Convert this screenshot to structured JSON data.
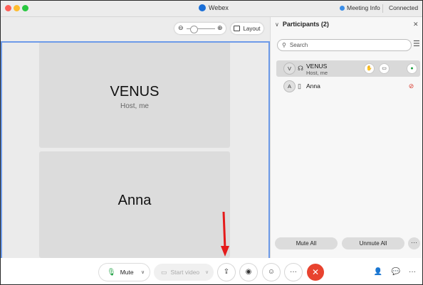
{
  "titlebar": {
    "app_title": "Webex",
    "meeting_info": "Meeting Info",
    "status": "Connected"
  },
  "stage": {
    "layout_label": "Layout",
    "zoom_level": 0.2,
    "tiles": [
      {
        "name": "VENUS",
        "subtitle": "Host, me"
      },
      {
        "name": "Anna",
        "subtitle": ""
      }
    ]
  },
  "participants": {
    "title": "Participants (2)",
    "search_placeholder": "Search",
    "list": [
      {
        "initial": "V",
        "name": "VENUS",
        "subtitle": "Host, me",
        "mic": "on"
      },
      {
        "initial": "A",
        "name": "Anna",
        "subtitle": "",
        "mic": "muted"
      }
    ],
    "mute_all_label": "Mute All",
    "unmute_all_label": "Unmute All",
    "more_label": "···"
  },
  "controls": {
    "mute_label": "Mute",
    "start_video_label": "Start video",
    "more_label": "···",
    "more2_label": "···"
  },
  "colors": {
    "accent": "#1a6fd8",
    "end_call": "#e8432f",
    "mic_on": "#1a9e3f",
    "mic_muted": "#d93b2f",
    "active_speaker_border": "#6d9ae8",
    "annotation_arrow": "#e51a1a"
  },
  "icons": [
    "traffic-lights",
    "webex-logo",
    "meeting-info-icon",
    "zoom-out-icon",
    "zoom-in-icon",
    "layout-grid-icon",
    "search-icon",
    "sort-icon",
    "share-icon",
    "record-icon",
    "reactions-icon",
    "end-call-icon",
    "participants-icon",
    "chat-icon"
  ]
}
